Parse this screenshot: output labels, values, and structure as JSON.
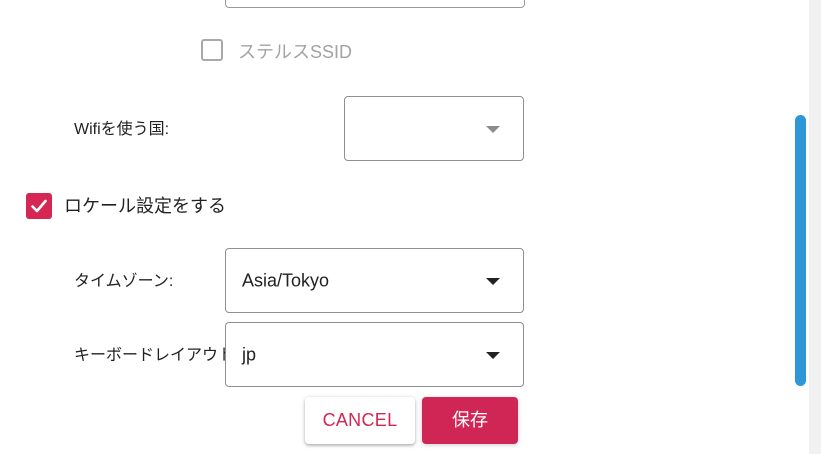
{
  "stealth_ssid": {
    "label": "ステルスSSID",
    "checked": false,
    "disabled": true
  },
  "wifi_country": {
    "label": "Wifiを使う国:",
    "value": ""
  },
  "locale": {
    "label": "ロケール設定をする",
    "checked": true
  },
  "timezone": {
    "label": "タイムゾーン:",
    "value": "Asia/Tokyo"
  },
  "keyboard": {
    "label": "キーボードレイアウト:",
    "value": "jp"
  },
  "buttons": {
    "cancel": "CANCEL",
    "save": "保存"
  },
  "colors": {
    "accent": "#d62754",
    "scrollbar": "#2e97d8",
    "disabled_text": "#a3a3a3"
  }
}
